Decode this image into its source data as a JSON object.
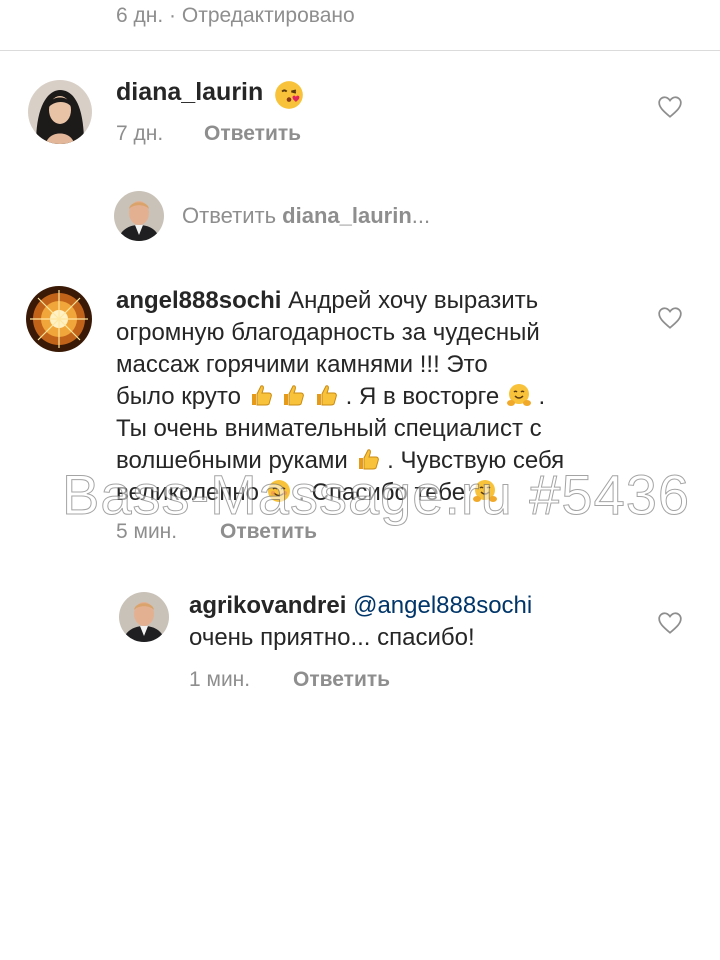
{
  "top": {
    "meta": "6 дн. · Отредактировано"
  },
  "comments": [
    {
      "username": "diana_laurin",
      "emoji": "kissing-heart-emoji",
      "time": "7 дн.",
      "reply_label": "Ответить",
      "reply_input": {
        "prefix": "Ответить",
        "mention": "diana_laurin",
        "suffix": "..."
      }
    },
    {
      "username": "angel888sochi",
      "lines": [
        "Андрей хочу выразить",
        "огромную благодарность за чудесный",
        "массаж горячими камнями !!! Это",
        "было круто",
        ". Я в восторге",
        ".",
        "Ты очень внимательный специалист с",
        "волшебными руками",
        ". Чувствую себя",
        "великолепно",
        ". Спасибо тебе"
      ],
      "time": "5 мин.",
      "reply_label": "Ответить"
    },
    {
      "username": "agrikovandrei",
      "mention": "@angel888sochi",
      "text": "очень приятно... спасибо!",
      "time": "1 мин.",
      "reply_label": "Ответить"
    }
  ],
  "watermark": "Bass-Massage.ru #5436",
  "colors": {
    "text": "#262626",
    "meta": "#8e8e8e",
    "mention": "#003569",
    "divider": "#dbdbdb"
  }
}
